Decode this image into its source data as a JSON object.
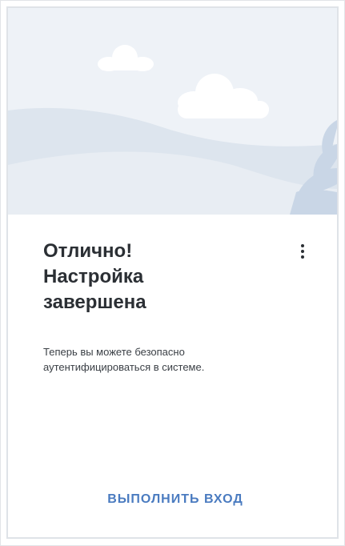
{
  "illustration": {
    "sky_color": "#eef2f7",
    "hill_color": "#dde5ee",
    "front_hill_color": "#ffffff",
    "plant_color": "#c9d6e6",
    "cloud_color": "#ffffff"
  },
  "dialog": {
    "title_lines": [
      "Отлично!",
      "Настройка",
      "завершена"
    ],
    "description_lines": [
      "Теперь вы можете безопасно",
      "аутентифицироваться в системе."
    ],
    "menu_icon": "more-vertical-icon",
    "action_label": "ВЫПОЛНИТЬ ВХОД",
    "accent_color": "#4a7bc0"
  }
}
